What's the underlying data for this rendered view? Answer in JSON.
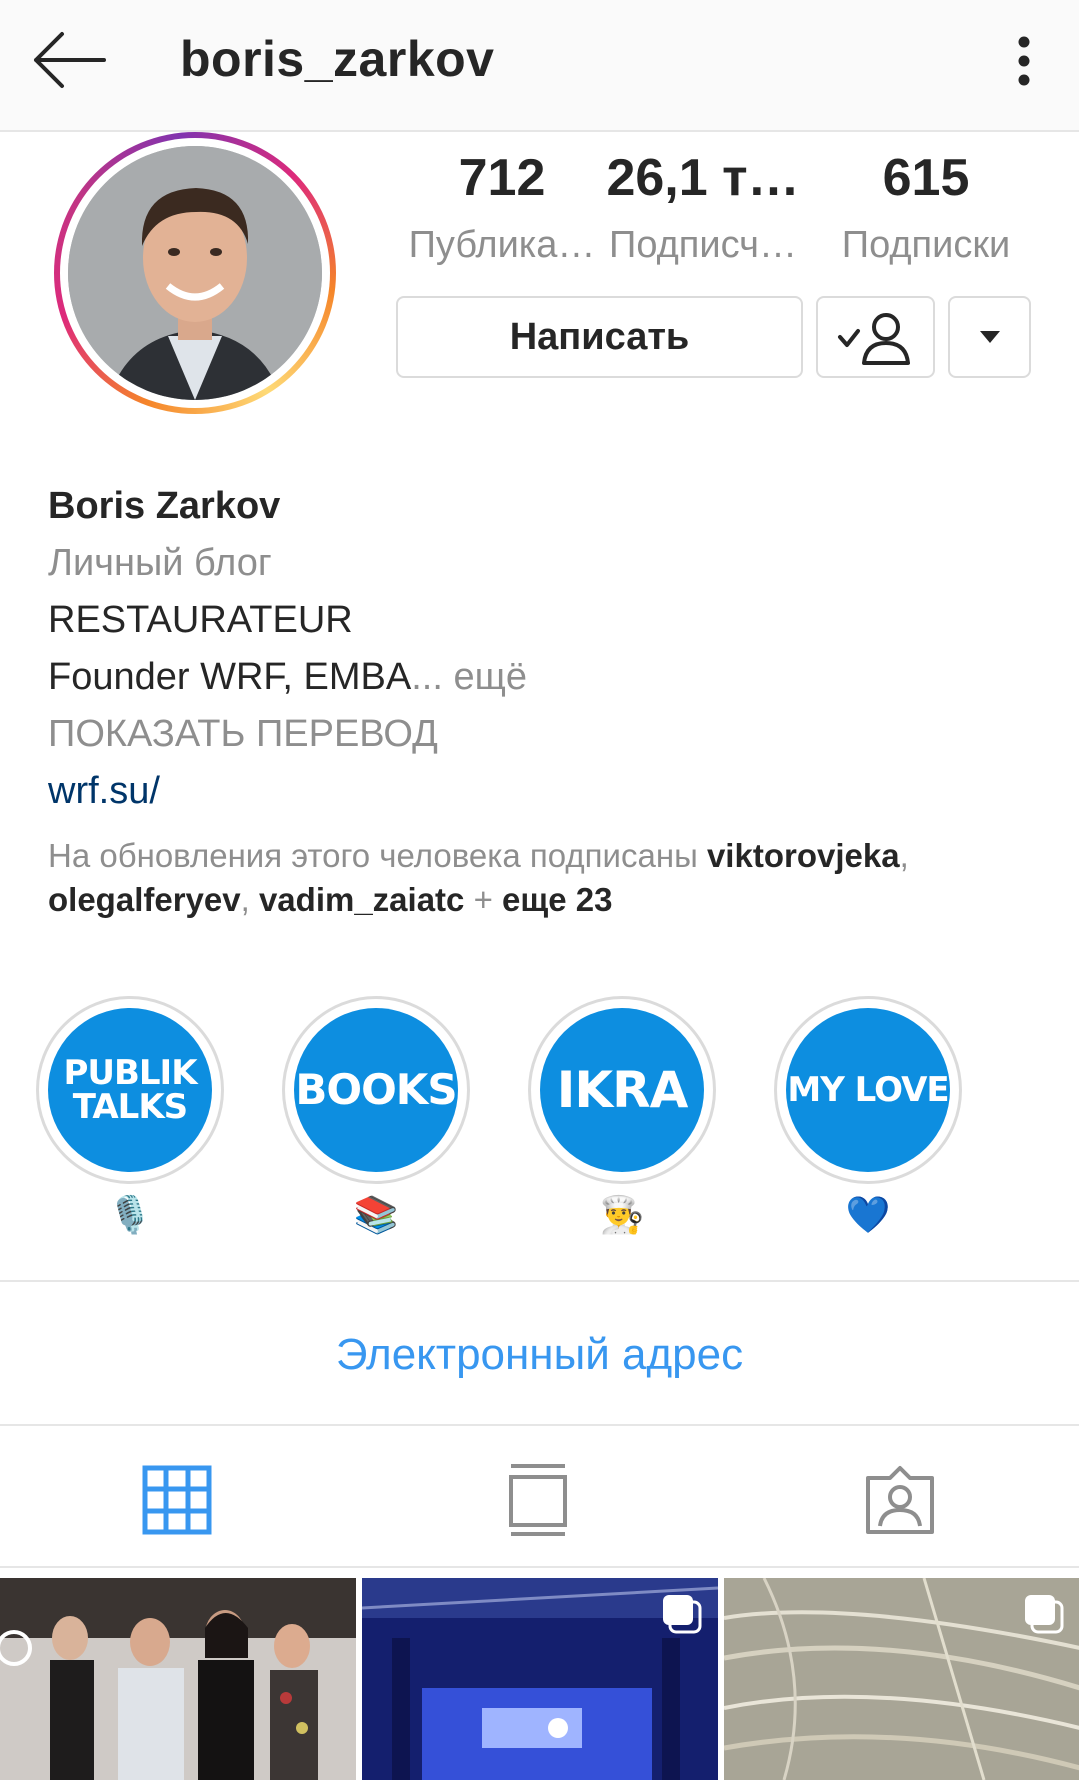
{
  "header": {
    "username": "boris_zarkov",
    "back_icon": "arrow-left-icon",
    "more_icon": "more-vertical-icon"
  },
  "stats": [
    {
      "value": "712",
      "label": "Публика…"
    },
    {
      "value": "26,1 т…",
      "label": "Подписч…"
    },
    {
      "value": "615",
      "label": "Подписки"
    }
  ],
  "actions": {
    "message_label": "Написать",
    "following_icon": "following-user-check-icon",
    "dropdown_icon": "triangle-down-icon"
  },
  "bio": {
    "name": "Boris Zarkov",
    "category": "Личный блог",
    "line1": "RESTAURATEUR",
    "line2": "Founder WRF, EMBA",
    "ellipsis": "...",
    "more": " ещё",
    "translate": "ПОКАЗАТЬ ПЕРЕВОД",
    "link": "wrf.su/"
  },
  "followed_by": {
    "prefix": "На обновления этого человека подписаны ",
    "users": [
      "viktorovjeka",
      "olegalferyev",
      "vadim_zaiatc"
    ],
    "sep": ", ",
    "plus": " + ",
    "more": "еще 23"
  },
  "highlights": [
    {
      "title_line1": "PUBLIK",
      "title_line2": "TALKS",
      "emoji": "🎙️"
    },
    {
      "title_line1": "BOOKS",
      "title_line2": "",
      "emoji": "📚"
    },
    {
      "title_line1": "IKRA",
      "title_line2": "",
      "emoji": "👨‍🍳"
    },
    {
      "title_line1": "MY LOVE",
      "title_line2": "",
      "emoji": "💙"
    }
  ],
  "contact": {
    "email_label": "Электронный адрес"
  },
  "tabs": [
    {
      "name": "grid-icon",
      "active": true
    },
    {
      "name": "feed-icon",
      "active": false
    },
    {
      "name": "tagged-icon",
      "active": false
    }
  ],
  "colors": {
    "accent": "#3897f0",
    "highlight_blue": "#0d8ee0",
    "link": "#003569",
    "muted": "#8e8e8e",
    "text": "#262626"
  }
}
